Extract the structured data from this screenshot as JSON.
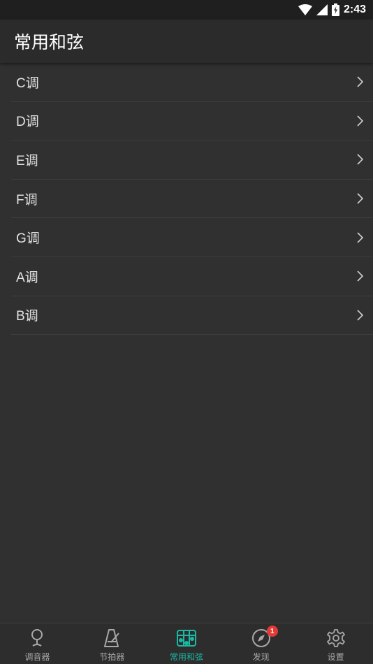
{
  "status_bar": {
    "time": "2:43",
    "icons": [
      "wifi-icon",
      "cellular-signal-icon",
      "battery-charging-icon"
    ]
  },
  "app_bar": {
    "title": "常用和弦"
  },
  "keys": [
    {
      "label": "C调",
      "icon": "chevron-right-icon"
    },
    {
      "label": "D调",
      "icon": "chevron-right-icon"
    },
    {
      "label": "E调",
      "icon": "chevron-right-icon"
    },
    {
      "label": "F调",
      "icon": "chevron-right-icon"
    },
    {
      "label": "G调",
      "icon": "chevron-right-icon"
    },
    {
      "label": "A调",
      "icon": "chevron-right-icon"
    },
    {
      "label": "B调",
      "icon": "chevron-right-icon"
    }
  ],
  "bottom_nav": {
    "active_color": "#19b9a6",
    "items": [
      {
        "label": "调音器",
        "icon": "tuner-icon",
        "active": false
      },
      {
        "label": "节拍器",
        "icon": "metronome-icon",
        "active": false
      },
      {
        "label": "常用和弦",
        "icon": "chord-grid-icon",
        "active": true
      },
      {
        "label": "发现",
        "icon": "compass-icon",
        "active": false,
        "badge": "1"
      },
      {
        "label": "设置",
        "icon": "settings-gear-icon",
        "active": false
      }
    ]
  }
}
